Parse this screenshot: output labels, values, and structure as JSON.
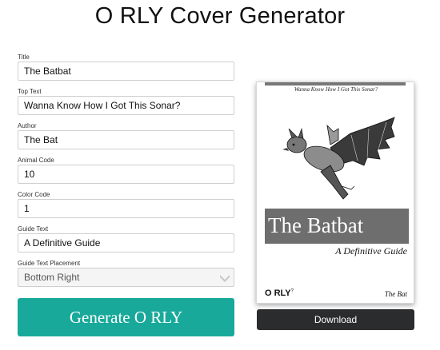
{
  "header": {
    "title": "O RLY Cover Generator"
  },
  "form": {
    "title": {
      "label": "Title",
      "value": "The Batbat"
    },
    "top_text": {
      "label": "Top Text",
      "value": "Wanna Know How I Got This Sonar?"
    },
    "author": {
      "label": "Author",
      "value": "The Bat"
    },
    "animal_code": {
      "label": "Animal Code",
      "value": "10"
    },
    "color_code": {
      "label": "Color Code",
      "value": "1"
    },
    "guide_text": {
      "label": "Guide Text",
      "value": "A Definitive Guide"
    },
    "guide_placement": {
      "label": "Guide Text Placement",
      "value": "Bottom Right"
    },
    "generate_label": "Generate O RLY"
  },
  "cover": {
    "top_text": "Wanna Know How I Got This Sonar?",
    "title": "The Batbat",
    "guide_text": "A Definitive Guide",
    "logo": "O RLY",
    "logo_mark": "?",
    "author": "The Bat",
    "accent_color": "#6e6e6e"
  },
  "download_label": "Download",
  "colors": {
    "generate_button": "#18a99a",
    "download_button": "#2b2c2e"
  }
}
